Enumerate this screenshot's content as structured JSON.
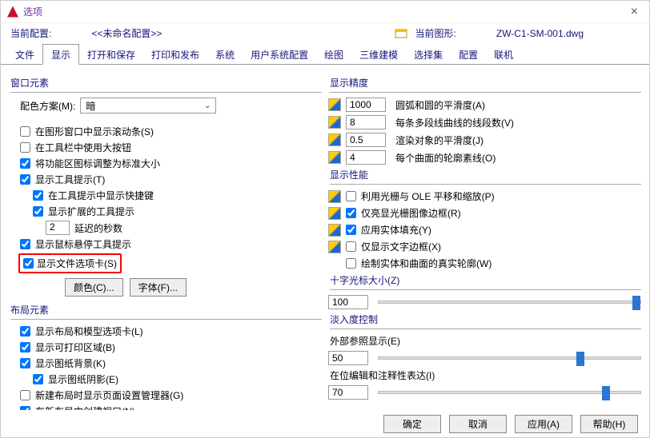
{
  "window": {
    "title": "选项"
  },
  "topbar": {
    "current_config_label": "当前配置:",
    "current_config_value": "<<未命名配置>>",
    "current_drawing_label": "当前图形:",
    "current_drawing_value": "ZW-C1-SM-001.dwg"
  },
  "tabs": [
    "文件",
    "显示",
    "打开和保存",
    "打印和发布",
    "系统",
    "用户系统配置",
    "绘图",
    "三维建模",
    "选择集",
    "配置",
    "联机"
  ],
  "active_tab_index": 1,
  "left": {
    "group1_title": "窗口元素",
    "color_scheme_label": "配色方案(M):",
    "color_scheme_value": "暗",
    "cb_scrollbars": "在图形窗口中显示滚动条(S)",
    "cb_bigbtn": "在工具栏中使用大按钮",
    "cb_ribbonstd": "将功能区图标调整为标准大小",
    "cb_tooltips": "显示工具提示(T)",
    "cb_shortcut": "在工具提示中显示快捷键",
    "cb_exttips": "显示扩展的工具提示",
    "delay_value": "2",
    "delay_label": "延迟的秒数",
    "cb_hover": "显示鼠标悬停工具提示",
    "cb_filetabs": "显示文件选项卡(S)",
    "btn_color": "颜色(C)...",
    "btn_font": "字体(F)...",
    "group2_title": "布局元素",
    "cb_layout": "显示布局和模型选项卡(L)",
    "cb_printable": "显示可打印区域(B)",
    "cb_paper": "显示图纸背景(K)",
    "cb_shadow": "显示图纸阴影(E)",
    "cb_pagesetup": "新建布局时显示页面设置管理器(G)",
    "cb_viewport": "在新布局中创建视口(N)"
  },
  "right": {
    "group1_title": "显示精度",
    "prec1_val": "1000",
    "prec1_label": "圆弧和圆的平滑度(A)",
    "prec2_val": "8",
    "prec2_label": "每条多段线曲线的线段数(V)",
    "prec3_val": "0.5",
    "prec3_label": "渲染对象的平滑度(J)",
    "prec4_val": "4",
    "prec4_label": "每个曲面的轮廓素线(O)",
    "group2_title": "显示性能",
    "perf1": "利用光栅与 OLE 平移和缩放(P)",
    "perf2": "仅亮显光栅图像边框(R)",
    "perf3": "应用实体填充(Y)",
    "perf4": "仅显示文字边框(X)",
    "perf5": "绘制实体和曲面的真实轮廓(W)",
    "group3_title": "十字光标大小(Z)",
    "cross_val": "100",
    "group4_title": "淡入度控制",
    "fade1_label": "外部参照显示(E)",
    "fade1_val": "50",
    "fade2_label": "在位编辑和注释性表达(I)",
    "fade2_val": "70"
  },
  "footer": {
    "ok": "确定",
    "cancel": "取消",
    "apply": "应用(A)",
    "help": "帮助(H)"
  }
}
